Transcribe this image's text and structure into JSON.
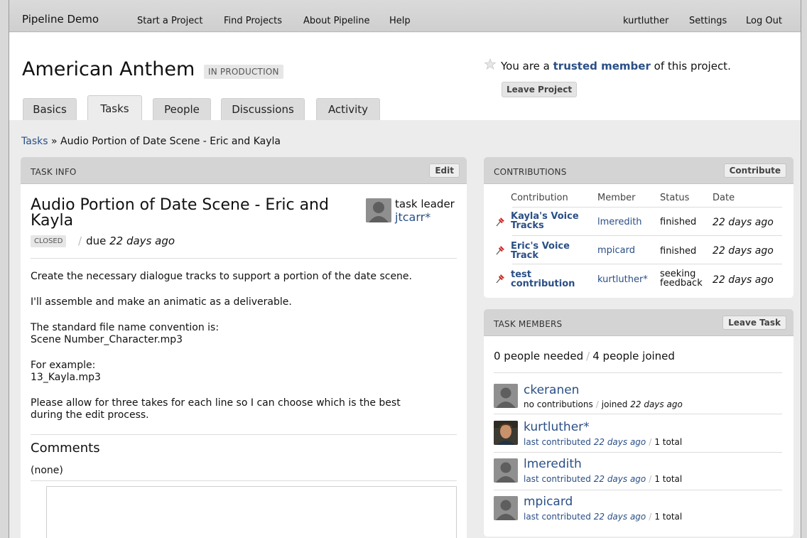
{
  "topnav": {
    "brand": "Pipeline Demo",
    "links": [
      "Start a Project",
      "Find Projects",
      "About Pipeline",
      "Help"
    ],
    "user": "kurtluther",
    "settings": "Settings",
    "logout": "Log Out"
  },
  "project": {
    "title": "American Anthem",
    "status": "IN PRODUCTION",
    "membership_prefix": "You are a",
    "membership_role": "trusted member",
    "membership_suffix": "of this project.",
    "leave_button": "Leave Project"
  },
  "tabs": [
    {
      "label": "Basics",
      "active": false
    },
    {
      "label": "Tasks",
      "active": true
    },
    {
      "label": "People",
      "active": false
    },
    {
      "label": "Discussions",
      "active": false
    },
    {
      "label": "Activity",
      "active": false
    }
  ],
  "breadcrumb": {
    "root": "Tasks",
    "separator": "»",
    "current": "Audio Portion of Date Scene - Eric and Kayla"
  },
  "task_info": {
    "header": "TASK INFO",
    "edit_button": "Edit",
    "title": "Audio Portion of Date Scene - Eric and Kayla",
    "leader_label": "task leader",
    "leader_name": "jtcarr*",
    "status_badge": "CLOSED",
    "due_label": "due",
    "due_value": "22 days ago",
    "description": [
      [
        "Create the necessary dialogue tracks to support a portion of the date scene."
      ],
      [
        "I'll assemble and make an animatic as a deliverable."
      ],
      [
        "The standard file name convention is:",
        "Scene Number_Character.mp3"
      ],
      [
        "For example:",
        "13_Kayla.mp3"
      ],
      [
        "Please allow for three takes for each line so I can choose which is the best",
        "during the edit process."
      ]
    ],
    "comments_heading": "Comments",
    "comments_empty": "(none)"
  },
  "contributions": {
    "header": "CONTRIBUTIONS",
    "contribute_button": "Contribute",
    "columns": [
      "Contribution",
      "Member",
      "Status",
      "Date"
    ],
    "rows": [
      {
        "name_lines": [
          "Kayla's Voice",
          "Tracks"
        ],
        "member": "lmeredith",
        "status_lines": [
          "finished"
        ],
        "date": "22 days ago"
      },
      {
        "name_lines": [
          "Eric's Voice",
          "Track"
        ],
        "member": "mpicard",
        "status_lines": [
          "finished"
        ],
        "date": "22 days ago"
      },
      {
        "name_lines": [
          "test",
          "contribution"
        ],
        "member": "kurtluther*",
        "status_lines": [
          "seeking",
          "feedback"
        ],
        "date": "22 days ago"
      }
    ]
  },
  "task_members": {
    "header": "TASK MEMBERS",
    "leave_button": "Leave Task",
    "needed": "0 people needed",
    "joined": "4 people joined",
    "members": [
      {
        "name": "ckeranen",
        "activity_label": "no contributions",
        "second_label": "joined",
        "when": "22 days ago",
        "total": "",
        "has_photo": false
      },
      {
        "name": "kurtluther*",
        "activity_label": "last contributed",
        "second_label": "",
        "when": "22 days ago",
        "total": "1 total",
        "has_photo": true
      },
      {
        "name": "lmeredith",
        "activity_label": "last contributed",
        "second_label": "",
        "when": "22 days ago",
        "total": "1 total",
        "has_photo": false
      },
      {
        "name": "mpicard",
        "activity_label": "last contributed",
        "second_label": "",
        "when": "22 days ago",
        "total": "1 total",
        "has_photo": false
      }
    ]
  },
  "colors": {
    "link": "#2a4f86",
    "pin": "#cc2222",
    "panel_header": "#d4d4d4"
  }
}
